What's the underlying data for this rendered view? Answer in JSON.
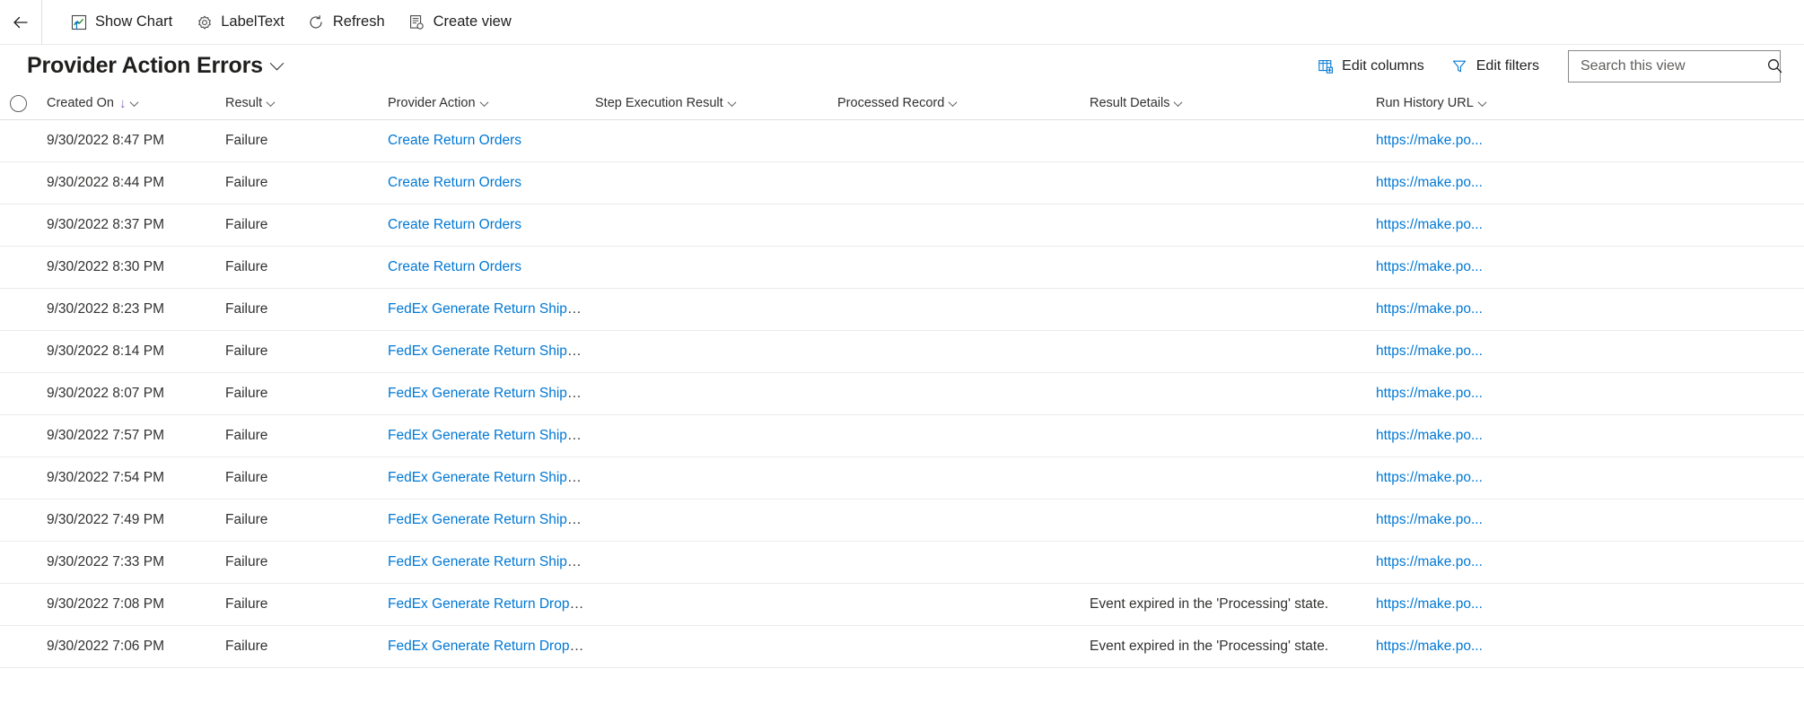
{
  "commandbar": {
    "back_icon": "arrow-left-icon",
    "items": [
      {
        "label": "Show Chart",
        "icon": "show-chart-icon"
      },
      {
        "label": "LabelText",
        "icon": "label-text-icon"
      },
      {
        "label": "Refresh",
        "icon": "refresh-icon"
      },
      {
        "label": "Create view",
        "icon": "create-view-icon"
      }
    ]
  },
  "header": {
    "title": "Provider Action Errors",
    "title_chevron": "chevron-down-icon",
    "edit_columns_label": "Edit columns",
    "edit_columns_icon": "edit-columns-icon",
    "edit_filters_label": "Edit filters",
    "edit_filters_icon": "filter-icon",
    "search": {
      "placeholder": "Search this view",
      "value": "",
      "icon": "search-icon"
    }
  },
  "grid": {
    "select_all_icon": "select-all-circle-icon",
    "sort_column": "Created On",
    "sort_direction": "ascending",
    "sort_arrow_glyph": "↓",
    "sort_arrow_color": "#8764b8",
    "link_color": "#0078d4",
    "columns": [
      {
        "key": "created_on",
        "label": "Created On"
      },
      {
        "key": "result",
        "label": "Result"
      },
      {
        "key": "provider",
        "label": "Provider Action"
      },
      {
        "key": "step",
        "label": "Step Execution Result"
      },
      {
        "key": "processed",
        "label": "Processed Record"
      },
      {
        "key": "details",
        "label": "Result Details"
      },
      {
        "key": "url",
        "label": "Run History URL"
      }
    ],
    "rows": [
      {
        "created_on": "9/30/2022 8:47 PM",
        "result": "Failure",
        "provider": "Create Return Orders",
        "step": "",
        "processed": "",
        "details": "",
        "url": "https://make.po..."
      },
      {
        "created_on": "9/30/2022 8:44 PM",
        "result": "Failure",
        "provider": "Create Return Orders",
        "step": "",
        "processed": "",
        "details": "",
        "url": "https://make.po..."
      },
      {
        "created_on": "9/30/2022 8:37 PM",
        "result": "Failure",
        "provider": "Create Return Orders",
        "step": "",
        "processed": "",
        "details": "",
        "url": "https://make.po..."
      },
      {
        "created_on": "9/30/2022 8:30 PM",
        "result": "Failure",
        "provider": "Create Return Orders",
        "step": "",
        "processed": "",
        "details": "",
        "url": "https://make.po..."
      },
      {
        "created_on": "9/30/2022 8:23 PM",
        "result": "Failure",
        "provider": "FedEx Generate Return Shipping La...",
        "step": "",
        "processed": "",
        "details": "",
        "url": "https://make.po..."
      },
      {
        "created_on": "9/30/2022 8:14 PM",
        "result": "Failure",
        "provider": "FedEx Generate Return Shipping La...",
        "step": "",
        "processed": "",
        "details": "",
        "url": "https://make.po..."
      },
      {
        "created_on": "9/30/2022 8:07 PM",
        "result": "Failure",
        "provider": "FedEx Generate Return Shipping La...",
        "step": "",
        "processed": "",
        "details": "",
        "url": "https://make.po..."
      },
      {
        "created_on": "9/30/2022 7:57 PM",
        "result": "Failure",
        "provider": "FedEx Generate Return Shipping La...",
        "step": "",
        "processed": "",
        "details": "",
        "url": "https://make.po..."
      },
      {
        "created_on": "9/30/2022 7:54 PM",
        "result": "Failure",
        "provider": "FedEx Generate Return Shipping La...",
        "step": "",
        "processed": "",
        "details": "",
        "url": "https://make.po..."
      },
      {
        "created_on": "9/30/2022 7:49 PM",
        "result": "Failure",
        "provider": "FedEx Generate Return Shipping La...",
        "step": "",
        "processed": "",
        "details": "",
        "url": "https://make.po..."
      },
      {
        "created_on": "9/30/2022 7:33 PM",
        "result": "Failure",
        "provider": "FedEx Generate Return Shipping La...",
        "step": "",
        "processed": "",
        "details": "",
        "url": "https://make.po..."
      },
      {
        "created_on": "9/30/2022 7:08 PM",
        "result": "Failure",
        "provider": "FedEx Generate Return Drop Locati...",
        "step": "",
        "processed": "",
        "details": "Event expired in the 'Processing' state.",
        "url": "https://make.po..."
      },
      {
        "created_on": "9/30/2022 7:06 PM",
        "result": "Failure",
        "provider": "FedEx Generate Return Drop Locati...",
        "step": "",
        "processed": "",
        "details": "Event expired in the 'Processing' state.",
        "url": "https://make.po..."
      }
    ]
  }
}
